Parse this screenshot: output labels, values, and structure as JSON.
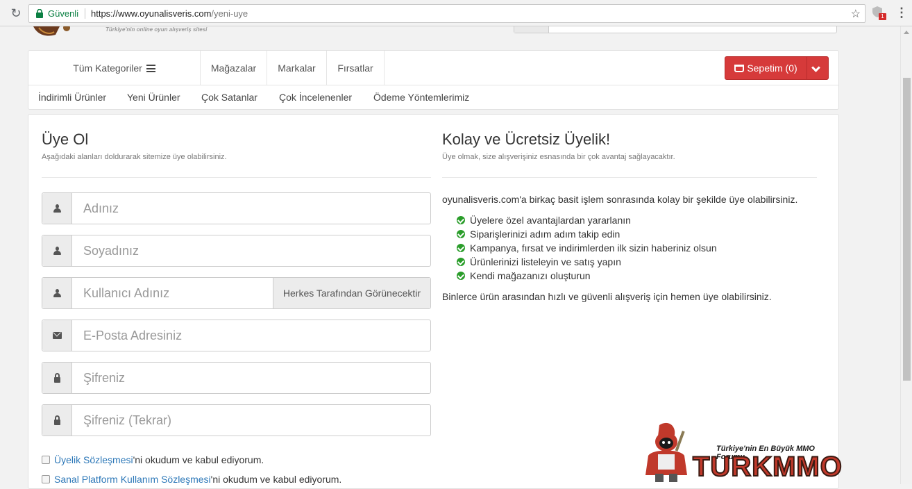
{
  "browser": {
    "secure_label": "Güvenli",
    "url_host": "https://www.oyunalisveris.com",
    "url_path": "/yeni-uye",
    "extension_badge": "1"
  },
  "header": {
    "tagline": "Türkiye'nin online oyun alışveriş sitesi"
  },
  "nav": {
    "categories_label": "Tüm Kategoriler",
    "links": [
      "Mağazalar",
      "Markalar",
      "Fırsatlar"
    ],
    "cart_label": "Sepetim (0)",
    "sub_links": [
      "İndirimli Ürünler",
      "Yeni Ürünler",
      "Çok Satanlar",
      "Çok İncelenenler",
      "Ödeme Yöntemlerimiz"
    ]
  },
  "register": {
    "title": "Üye Ol",
    "subtitle": "Aşağıdaki alanları doldurarak sitemize üye olabilirsiniz.",
    "fields": [
      {
        "placeholder": "Adınız",
        "icon": "user-icon"
      },
      {
        "placeholder": "Soyadınız",
        "icon": "user-icon"
      },
      {
        "placeholder": "Kullanıcı Adınız",
        "icon": "user-icon",
        "addon": "Herkes Tarafından Görünecektir"
      },
      {
        "placeholder": "E-Posta Adresiniz",
        "icon": "envelope-icon"
      },
      {
        "placeholder": "Şifreniz",
        "icon": "lock-icon"
      },
      {
        "placeholder": "Şifreniz (Tekrar)",
        "icon": "lock-icon"
      }
    ],
    "agreements": [
      {
        "link": "Üyelik Sözleşmesi",
        "rest": "'ni okudum ve kabul ediyorum."
      },
      {
        "link": "Sanal Platform Kullanım Sözleşmesi",
        "rest": "'ni okudum ve kabul ediyorum."
      }
    ]
  },
  "info": {
    "title": "Kolay ve Ücretsiz Üyelik!",
    "subtitle": "Üye olmak, size alışverişiniz esnasında bir çok avantaj sağlayacaktır.",
    "intro": "oyunalisveris.com'a birkaç basit işlem sonrasında kolay bir şekilde üye olabilirsiniz.",
    "benefits": [
      "Üyelere özel avantajlardan yararlanın",
      "Siparişlerinizi adım adım takip edin",
      "Kampanya, fırsat ve indirimlerden ilk sizin haberiniz olsun",
      "Ürünlerinizi listeleyin ve satış yapın",
      "Kendi mağazanızı oluşturun"
    ],
    "outro": "Binlerce ürün arasından hızlı ve güvenli alışveriş için hemen üye olabilirsiniz."
  },
  "watermark": {
    "slogan": "Türkiye'nin En Büyük MMO Forumu",
    "brand": "TURKMMO"
  },
  "colors": {
    "cart_red": "#d63a3a",
    "link_blue": "#2d78b8",
    "check_green": "#2a9d2a",
    "secure_green": "#0b8043"
  }
}
